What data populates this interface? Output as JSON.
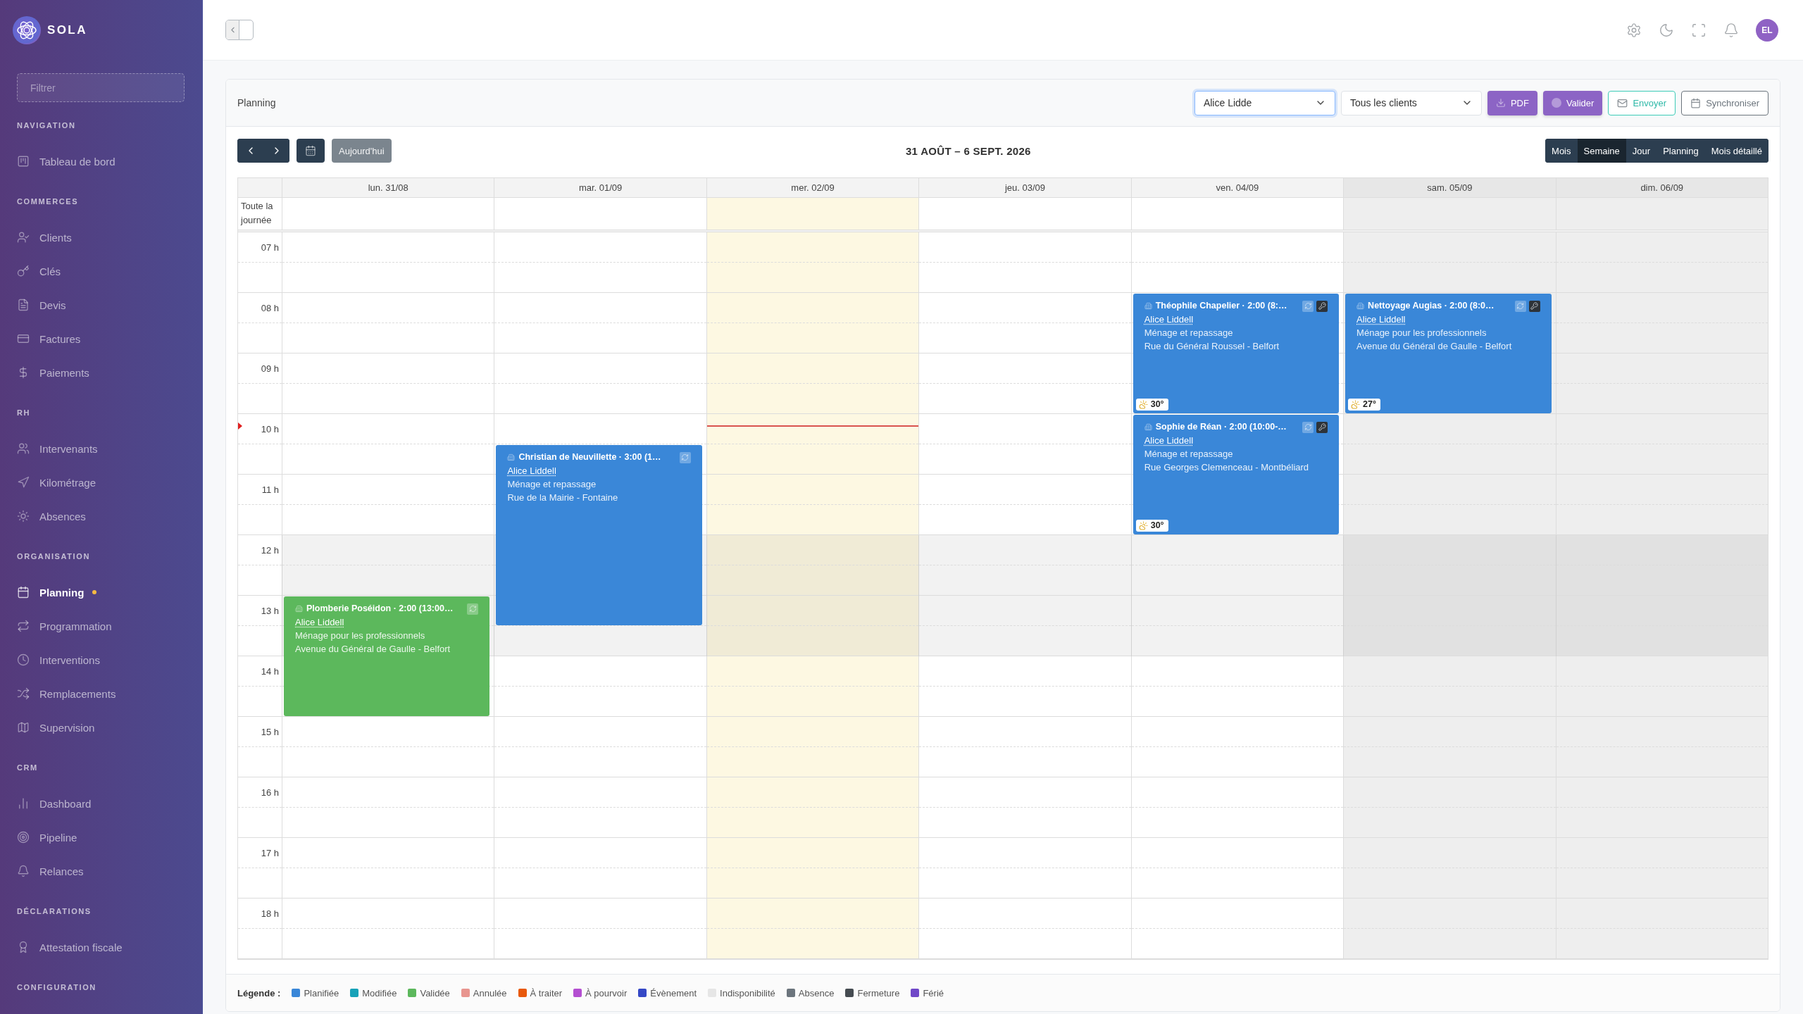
{
  "sidebar": {
    "brand": "SOLA",
    "filter": {
      "placeholder": "Filtrer"
    },
    "sections": [
      {
        "title": "NAVIGATION",
        "items": [
          {
            "label": "Tableau de bord",
            "selected": false,
            "indicator": false
          }
        ]
      },
      {
        "title": "COMMERCES",
        "items": [
          {
            "label": "Clients",
            "selected": false,
            "indicator": false
          },
          {
            "label": "Clés",
            "selected": false,
            "indicator": false
          },
          {
            "label": "Devis",
            "selected": false,
            "indicator": false
          },
          {
            "label": "Factures",
            "selected": false,
            "indicator": false
          },
          {
            "label": "Paiements",
            "selected": false,
            "indicator": false
          }
        ]
      },
      {
        "title": "RH",
        "items": [
          {
            "label": "Intervenants",
            "selected": false,
            "indicator": false
          },
          {
            "label": "Kilométrage",
            "selected": false,
            "indicator": false
          },
          {
            "label": "Absences",
            "selected": false,
            "indicator": false
          }
        ]
      },
      {
        "title": "ORGANISATION",
        "items": [
          {
            "label": "Planning",
            "selected": true,
            "indicator": true
          },
          {
            "label": "Programmation",
            "selected": false,
            "indicator": false
          },
          {
            "label": "Interventions",
            "selected": false,
            "indicator": false
          },
          {
            "label": "Remplacements",
            "selected": false,
            "indicator": false
          },
          {
            "label": "Supervision",
            "selected": false,
            "indicator": false
          }
        ]
      },
      {
        "title": "CRM",
        "items": [
          {
            "label": "Dashboard",
            "selected": false,
            "indicator": false
          },
          {
            "label": "Pipeline",
            "selected": false,
            "indicator": false
          },
          {
            "label": "Relances",
            "selected": false,
            "indicator": false
          }
        ]
      },
      {
        "title": "DÉCLARATIONS",
        "items": [
          {
            "label": "Attestation fiscale",
            "selected": false,
            "indicator": false
          }
        ]
      },
      {
        "title": "CONFIGURATION"
      }
    ]
  },
  "topbar": {
    "avatar": "EL"
  },
  "planning": {
    "title": "Planning",
    "employee_select": {
      "value": "Alice Lidde",
      "focused": true
    },
    "client_select": {
      "value": "Tous les clients",
      "focused": false
    },
    "actions": [
      {
        "label": "PDF",
        "kind": "primary"
      },
      {
        "label": "Valider",
        "kind": "primary"
      },
      {
        "label": "Envoyer",
        "kind": "info"
      },
      {
        "label": "Synchroniser",
        "kind": "secondary"
      }
    ],
    "calendar": {
      "today_button": "Aujourd'hui",
      "range": "31 AOÛT – 6 SEPT. 2026",
      "views": [
        {
          "label": "Mois",
          "selected": false
        },
        {
          "label": "Semaine",
          "selected": true
        },
        {
          "label": "Jour",
          "selected": false
        },
        {
          "label": "Planning",
          "selected": false
        },
        {
          "label": "Mois détaillé",
          "selected": false
        }
      ],
      "all_day_label": "Toute la journée",
      "hours": [
        {
          "label": "07 h",
          "break": false
        },
        {
          "label": "08 h",
          "break": false
        },
        {
          "label": "09 h",
          "break": false
        },
        {
          "label": "10 h",
          "break": false
        },
        {
          "label": "11 h",
          "break": false
        },
        {
          "label": "12 h",
          "break": true
        },
        {
          "label": "13 h",
          "break": true
        },
        {
          "label": "14 h",
          "break": false
        },
        {
          "label": "15 h",
          "break": false
        },
        {
          "label": "16 h",
          "break": false
        },
        {
          "label": "17 h",
          "break": false
        },
        {
          "label": "18 h",
          "break": false
        }
      ],
      "days": [
        {
          "label": "lun. 31/08",
          "today": false,
          "weekend": false,
          "events": [
            {
              "title": "Plomberie Poséidon · 2:00 (13:00…",
              "employee": "Alice Liddell",
              "service": "Ménage pour les professionnels",
              "address": "Avenue du Général de Gaulle - Belfort",
              "color": "#5cb85c",
              "recurring": true,
              "key": false
            }
          ]
        },
        {
          "label": "mar. 01/09",
          "today": false,
          "weekend": false,
          "events": [
            {
              "title": "Christian de Neuvillette · 3:00 (1…",
              "employee": "Alice Liddell",
              "service": "Ménage et repassage",
              "address": "Rue de la Mairie - Fontaine",
              "color": "#3a87d8",
              "recurring": true,
              "key": false
            }
          ]
        },
        {
          "label": "mer. 02/09",
          "today": true,
          "weekend": false
        },
        {
          "label": "jeu. 03/09",
          "today": false,
          "weekend": false
        },
        {
          "label": "ven. 04/09",
          "today": false,
          "weekend": false,
          "events": [
            {
              "title": "Théophile Chapelier · 2:00 (8:…",
              "employee": "Alice Liddell",
              "service": "Ménage et repassage",
              "address": "Rue du Général Roussel - Belfort",
              "color": "#3a87d8",
              "recurring": true,
              "key": true,
              "weather": "30°"
            },
            {
              "title": "Sophie de Réan · 2:00 (10:00-…",
              "employee": "Alice Liddell",
              "service": "Ménage et repassage",
              "address": "Rue Georges Clemenceau - Montbéliard",
              "color": "#3a87d8",
              "recurring": true,
              "key": true,
              "weather": "30°"
            }
          ]
        },
        {
          "label": "sam. 05/09",
          "today": false,
          "weekend": true,
          "events": [
            {
              "title": "Nettoyage Augias · 2:00 (8:0…",
              "employee": "Alice Liddell",
              "service": "Ménage pour les professionnels",
              "address": "Avenue du Général de Gaulle - Belfort",
              "color": "#3a87d8",
              "recurring": true,
              "key": true,
              "weather": "27°"
            }
          ]
        },
        {
          "label": "dim. 06/09",
          "today": false,
          "weekend": true
        }
      ]
    },
    "legend": {
      "title": "Légende :",
      "items": [
        {
          "label": "Planifiée",
          "color": "#3a87d8"
        },
        {
          "label": "Modifiée",
          "color": "#17a2b8"
        },
        {
          "label": "Validée",
          "color": "#5cb85c"
        },
        {
          "label": "Annulée",
          "color": "#e8958f"
        },
        {
          "label": "À traiter",
          "color": "#e8590c"
        },
        {
          "label": "À pourvoir",
          "color": "#b44fd1"
        },
        {
          "label": "Évènement",
          "color": "#3548c6"
        },
        {
          "label": "Indisponibilité",
          "color": "#e6e6e6"
        },
        {
          "label": "Absence",
          "color": "#6c757d"
        },
        {
          "label": "Fermeture",
          "color": "#454b51"
        },
        {
          "label": "Férié",
          "color": "#7048c8"
        }
      ]
    }
  }
}
